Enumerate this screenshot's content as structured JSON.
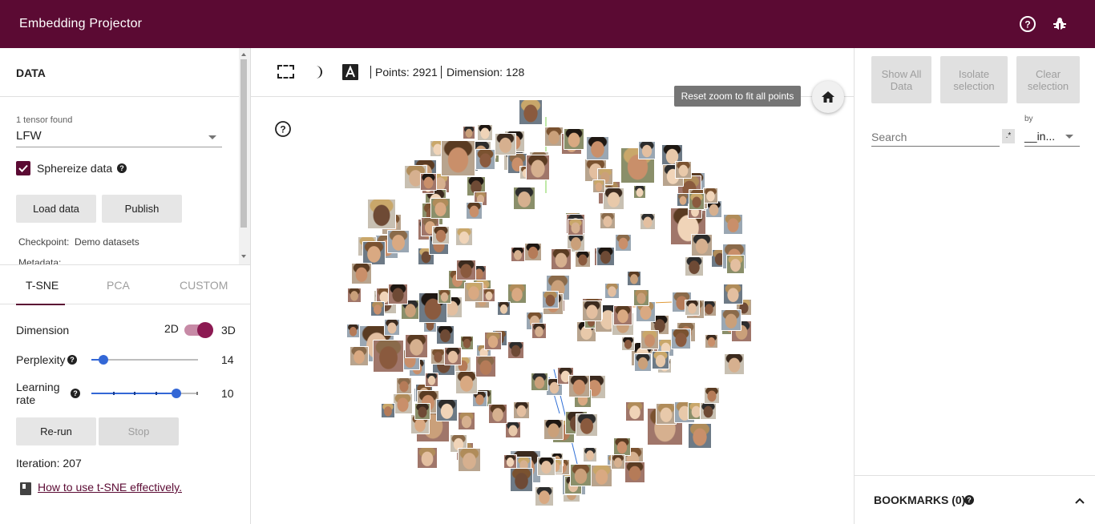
{
  "app": {
    "title": "Embedding Projector"
  },
  "colors": {
    "brand": "#5b0a33",
    "accent": "#3367d6"
  },
  "topbar": {
    "icons": [
      "help-icon",
      "bug-icon"
    ]
  },
  "data_panel": {
    "header": "DATA",
    "tensor_count_label": "1 tensor found",
    "tensor_selected": "LFW",
    "sphereize_label": "Sphereize data",
    "sphereize_checked": true,
    "load_button": "Load data",
    "publish_button": "Publish",
    "checkpoint_label": "Checkpoint:",
    "checkpoint_value": "Demo datasets",
    "metadata_label": "Metadata:"
  },
  "projection_tabs": [
    {
      "label": "T-SNE",
      "active": true
    },
    {
      "label": "PCA",
      "active": false
    },
    {
      "label": "CUSTOM",
      "active": false
    }
  ],
  "tsne": {
    "dimension_label": "Dimension",
    "dim_2d": "2D",
    "dim_3d": "3D",
    "dim_3d_on": true,
    "perplexity_label": "Perplexity",
    "perplexity_value": "14",
    "perplexity_level": 0.11,
    "learning_rate_label": "Learning rate",
    "learning_rate_value": "10",
    "learning_rate_level": 0.8,
    "rerun_button": "Re-run",
    "stop_button": "Stop",
    "iteration_text": "Iteration: 207",
    "help_link": "How to use t-SNE effectively."
  },
  "toolbar": {
    "points_text": "Points: 2921",
    "dimension_text": "Dimension: 128",
    "tooltip": "Reset zoom to fit all points"
  },
  "inspector": {
    "show_all": "Show All Data",
    "isolate": "Isolate selection",
    "clear": "Clear selection",
    "search_placeholder": "Search",
    "regex_label": ".*",
    "by_label": "by",
    "by_value": "__in..."
  },
  "bookmarks": {
    "label": "BOOKMARKS (0)"
  }
}
